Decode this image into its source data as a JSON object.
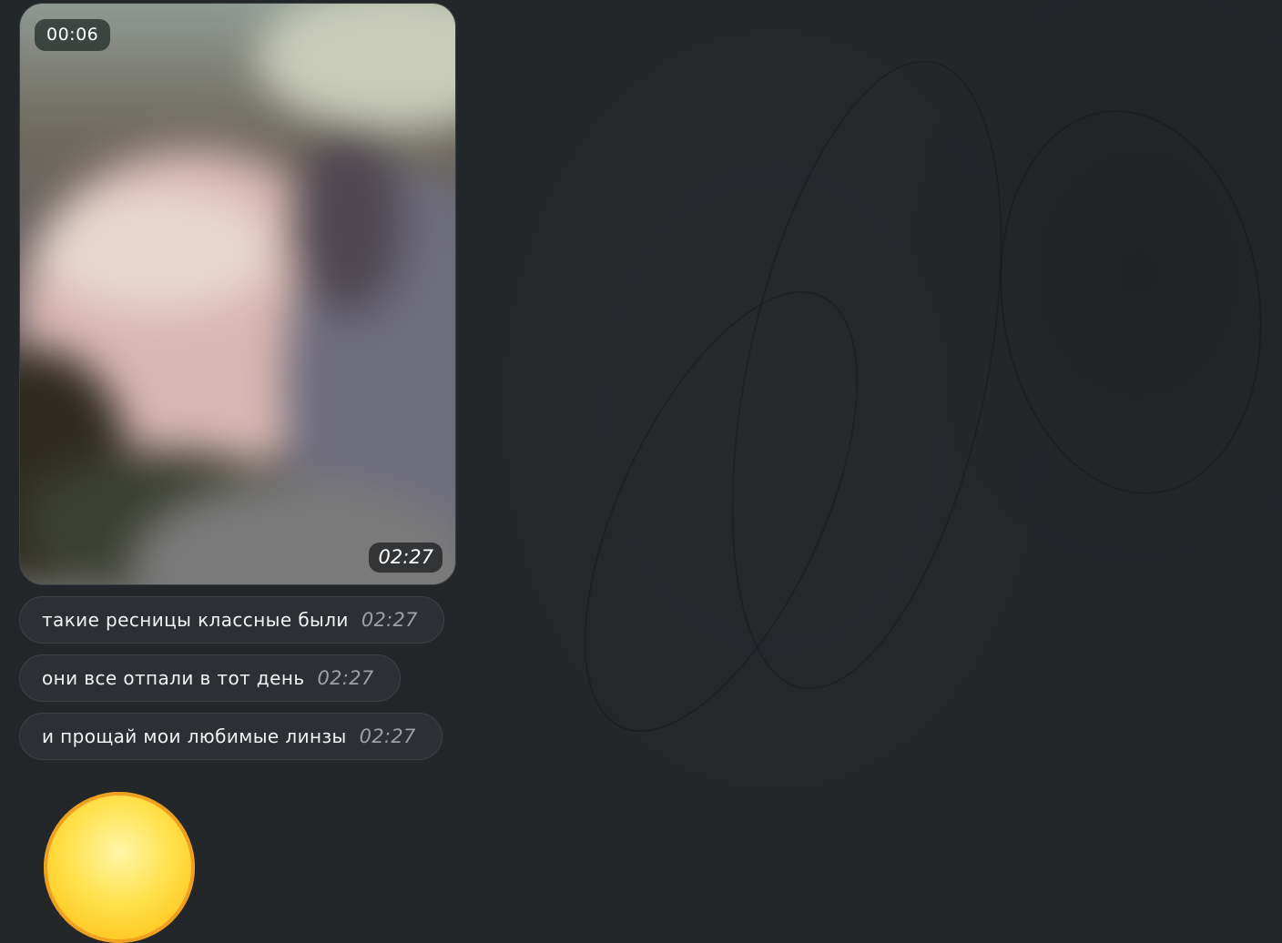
{
  "video_message": {
    "duration": "00:06",
    "time": "02:27"
  },
  "messages": [
    {
      "text": "такие ресницы классные были",
      "time": "02:27"
    },
    {
      "text": "они все отпали в тот день",
      "time": "02:27"
    },
    {
      "text": "и прощай мои любимые линзы",
      "time": "02:27"
    }
  ],
  "sticker": {
    "icon": "smiley-emoji-icon",
    "color": "#ffe14a"
  },
  "colors": {
    "background": "#23272a",
    "bubble": "#2c2f33",
    "text": "#f2f2f2",
    "timestamp": "#9aa0a6"
  }
}
